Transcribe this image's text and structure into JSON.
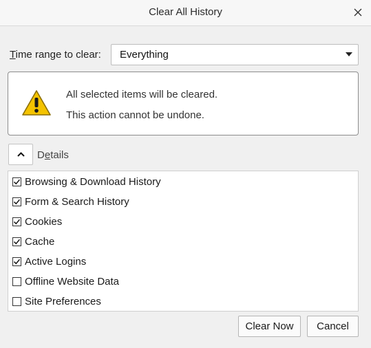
{
  "window": {
    "title": "Clear All History"
  },
  "time_range": {
    "label_prefix": "T",
    "label_rest": "ime range to clear:",
    "selected": "Everything"
  },
  "warning": {
    "line1": "All selected items will be cleared.",
    "line2": "This action cannot be undone."
  },
  "details": {
    "label_prefix": "D",
    "label_underlined": "e",
    "label_rest": "tails",
    "expanded": true
  },
  "items": [
    {
      "label": "Browsing & Download History",
      "checked": true
    },
    {
      "label": "Form & Search History",
      "checked": true
    },
    {
      "label": "Cookies",
      "checked": true
    },
    {
      "label": "Cache",
      "checked": true
    },
    {
      "label": "Active Logins",
      "checked": true
    },
    {
      "label": "Offline Website Data",
      "checked": false
    },
    {
      "label": "Site Preferences",
      "checked": false
    }
  ],
  "buttons": {
    "clear_now": "Clear Now",
    "cancel": "Cancel"
  },
  "icons": {
    "close": "close-icon",
    "dropdown": "chevron-down-icon",
    "warning": "warning-triangle-icon",
    "collapse": "chevron-up-icon",
    "check": "checkmark-icon"
  },
  "colors": {
    "warning_yellow": "#f4c300",
    "dialog_bg": "#f0f0f0"
  }
}
